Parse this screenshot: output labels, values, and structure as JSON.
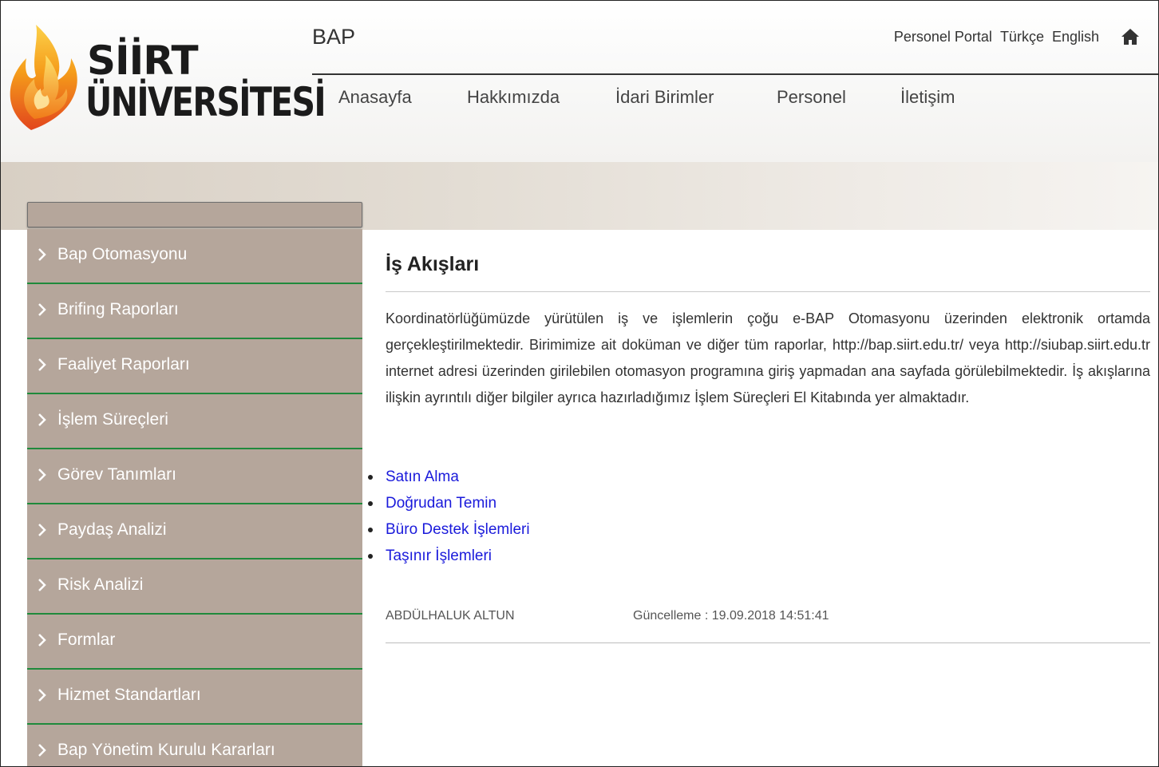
{
  "header": {
    "logo_line1": "SİİRT",
    "logo_line2": "ÜNİVERSİTESİ",
    "site_title": "BAP",
    "top_links": [
      "Personel Portal",
      "Türkçe",
      "English"
    ],
    "home_icon": "home-icon",
    "nav": [
      "Anasayfa",
      "Hakkımızda",
      "İdari Birimler",
      "Personel",
      "İletişim"
    ]
  },
  "sidebar": {
    "items": [
      "Bap Otomasyonu",
      "Brifing Raporları",
      "Faaliyet Raporları",
      "İşlem Süreçleri",
      "Görev Tanımları",
      "Paydaş Analizi",
      "Risk Analizi",
      "Formlar",
      "Hizmet Standartları",
      "Bap Yönetim Kurulu Kararları"
    ],
    "item_icon": "chevron-right-icon"
  },
  "main": {
    "title": "İş Akışları",
    "paragraph": "Koordinatörlüğümüzde yürütülen iş ve işlemlerin çoğu e-BAP Otomasyonu üzerinden elektronik ortamda gerçekleştirilmektedir. Birimimize ait doküman ve diğer tüm raporlar, http://bap.siirt.edu.tr/ veya http://siubap.siirt.edu.tr internet adresi üzerinden girilebilen otomasyon programına giriş yapmadan ana sayfada görülebilmektedir. İş akışlarına ilişkin ayrıntılı diğer bilgiler ayrıca hazırladığımız İşlem Süreçleri El Kitabında yer almaktadır.",
    "links": [
      "Satın Alma",
      "Doğrudan Temin",
      "Büro Destek İşlemleri",
      "Taşınır İşlemleri"
    ],
    "author": "ABDÜLHALUK ALTUN",
    "updated": "Güncelleme : 19.09.2018 14:51:41"
  },
  "colors": {
    "sidebar_bg": "#b5a69b",
    "sidebar_divider": "#1f8a3c",
    "link": "#1a1adb"
  }
}
